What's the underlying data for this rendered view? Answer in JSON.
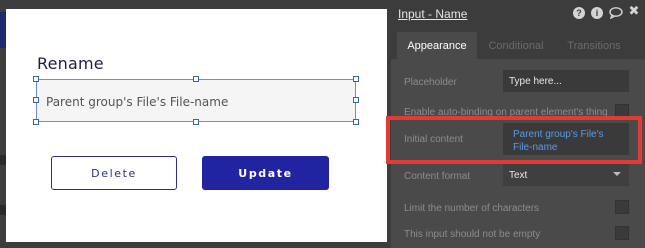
{
  "popup": {
    "title": "Rename",
    "input_value": "Parent group's File's File-name",
    "delete_label": "Delete",
    "update_label": "Update"
  },
  "panel": {
    "title": "Input - Name",
    "icons": [
      "help-icon",
      "info-icon",
      "comment-icon",
      "close-icon"
    ],
    "help_glyph": "?",
    "info_glyph": "i",
    "close_glyph": "✖",
    "tabs": [
      "Appearance",
      "Conditional",
      "Transitions"
    ],
    "active_tab": "Appearance",
    "placeholder_label": "Placeholder",
    "placeholder_value": "Type here...",
    "auto_binding_label": "Enable auto-binding on parent element's thing",
    "initial_content_label": "Initial content",
    "initial_content_value": "Parent group's File's File-name",
    "content_format_label": "Content format",
    "content_format_value": "Text",
    "limit_chars_label": "Limit the number of characters",
    "not_empty_label": "This input should not be empty"
  },
  "colors": {
    "primary_button": "#2124a0",
    "highlight": "#e03c34",
    "dynamic_text": "#5a9ae6",
    "panel_bg": "#4a4a4a"
  }
}
